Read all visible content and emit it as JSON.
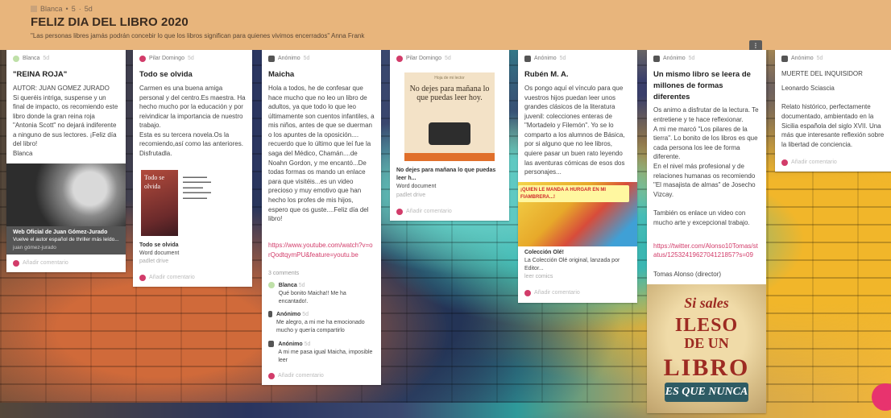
{
  "header": {
    "author": "Blanca",
    "dot": "•",
    "count": "5",
    "sep": "·",
    "time": "5d",
    "title": "FELIZ DIA DEL LIBRO 2020",
    "subtitle": "\"Las personas libres jamás podrán concebir lo que los libros significan para quienes vivimos encerrados\" Anna Frank",
    "menu_icon": "⁝"
  },
  "add_comment": "Añadir comentario",
  "cards": {
    "c1": {
      "author": "Blanca",
      "time": "5d",
      "title": "\"REINA ROJA\"",
      "body": "AUTOR: JUAN GOMEZ JURADO\nSi queréis intriga, suspense y un final de impacto, os recomiendo este libro donde la gran reina roja \"Antonia Scott\" no dejará indiferente a ninguno de sus lectores. ¡Feliz día del libro!\nBlanca",
      "link_title": "Web Oficial de Juan Gómez-Jurado",
      "link_desc": "Vuelve el autor español de thriller más leído...",
      "link_source": "juan gómez-jurado"
    },
    "c2": {
      "author": "Pilar Domingo",
      "time": "5d",
      "title": "Todo se olvida",
      "body": "Carmen es una buena amiga personal y del centro.Es maestra. Ha hecho mucho por la educación y por reivindicar la importancia de nuestro trabajo.\n Esta es su tercera novela.Os la recomiendo,así como las anteriores. Disfrutadla.",
      "cover_text": "Todo se olvida",
      "attach_title": "Todo se olvida",
      "attach_type": "Word document",
      "attach_source": "padlet drive"
    },
    "c3": {
      "author": "Anónimo",
      "time": "5d",
      "title": "Maicha",
      "body": "Hola a todos, he de confesar que hace mucho que no leo un libro de adultos, ya que todo lo que leo últimamente son cuentos infantiles, a mis niños, antes de que se duerman o los apuntes de la oposición.... recuerdo que lo último que leí fue la saga del Médico, Chamán....de Noahn Gordon, y me encantó...De todas formas os mando un enlace para que visitéis...es un video precioso y muy emotivo que han hecho los profes de mis hijos, espero que os guste....Feliz día del libro!",
      "link": "https://www.youtube.com/watch?v=orQodtqymPU&feature=youtu.be",
      "comments_count": "3 comments",
      "comments": [
        {
          "who": "Blanca",
          "time": "5d",
          "text": "Qué bonito Maicha!! Me ha encantado!."
        },
        {
          "who": "Anónimo",
          "time": "5d",
          "text": "Me alegro, a mi me ha emocionado mucho y quería compartirlo"
        },
        {
          "who": "Anónimo",
          "time": "5d",
          "text": "A mi me pasa igual Maicha, imposible leer"
        }
      ]
    },
    "c4": {
      "author": "Pilar Domingo",
      "time": "5d",
      "img_small": "Hoja de mi lector",
      "img_big": "No dejes para mañana lo que puedas leer hoy.",
      "attach_title": "No dejes para mañana lo que puedas leer h...",
      "attach_type": "Word document",
      "attach_source": "padlet drive"
    },
    "c5": {
      "author": "Anónimo",
      "time": "5d",
      "title": "Rubén M. A.",
      "body": "Os pongo aquí el vínculo para que vuestros hijos puedan leer unos grandes clásicos de la literatura juvenil: colecciones enteras de \"Mortadelo y Filemón\". Yo se lo comparto a los alumnos de Básica, por si alguno que no lee libros, quiere pasar un buen rato leyendo las aventuras cómicas de esos dos personajes...",
      "img_banner": "¡QUIEN LE MANDA A HURGAR EN MI FIAMBRERA...!",
      "link_title": "Colección Olé!",
      "link_desc": "La Colección Olé original, lanzada por Editor...",
      "link_source": "leer comics"
    },
    "c6": {
      "author": "Anónimo",
      "time": "5d",
      "title": "Un mismo libro se leera de millones de formas diferentes",
      "body": "Os animo a disfrutar de la lectura. Te entretiene y te hace reflexionar.\nA mi me marcó  \"Los pilares de la tierra\". Lo bonito de los libros es que cada persona los lee de forma diferente.\nEn el nivel más profesional y de relaciones humanas os recomiendo \"El masajista de almas\" de Josecho Vizcay.\n\nTambién os enlace un video con mucho arte y excepcional trabajo.",
      "link": "https://twitter.com/Alonso10Tomas/status/1253241962704121857?s=09",
      "signature": "Tomas Alonso (director)",
      "poster": [
        "Si sales",
        "ILESO",
        "DE UN",
        "LIBRO",
        "ES QUE NUNCA"
      ]
    },
    "c7": {
      "author": "Anónimo",
      "time": "5d",
      "title": "MUERTE DEL INQUISIDOR",
      "subtitle": "Leonardo Sciascia",
      "body": "Relato histórico, perfectamente documentado, ambientado en la Sicilia española del siglo XVII. Una más que interesante reflexión sobre la libertad de conciencia."
    }
  }
}
